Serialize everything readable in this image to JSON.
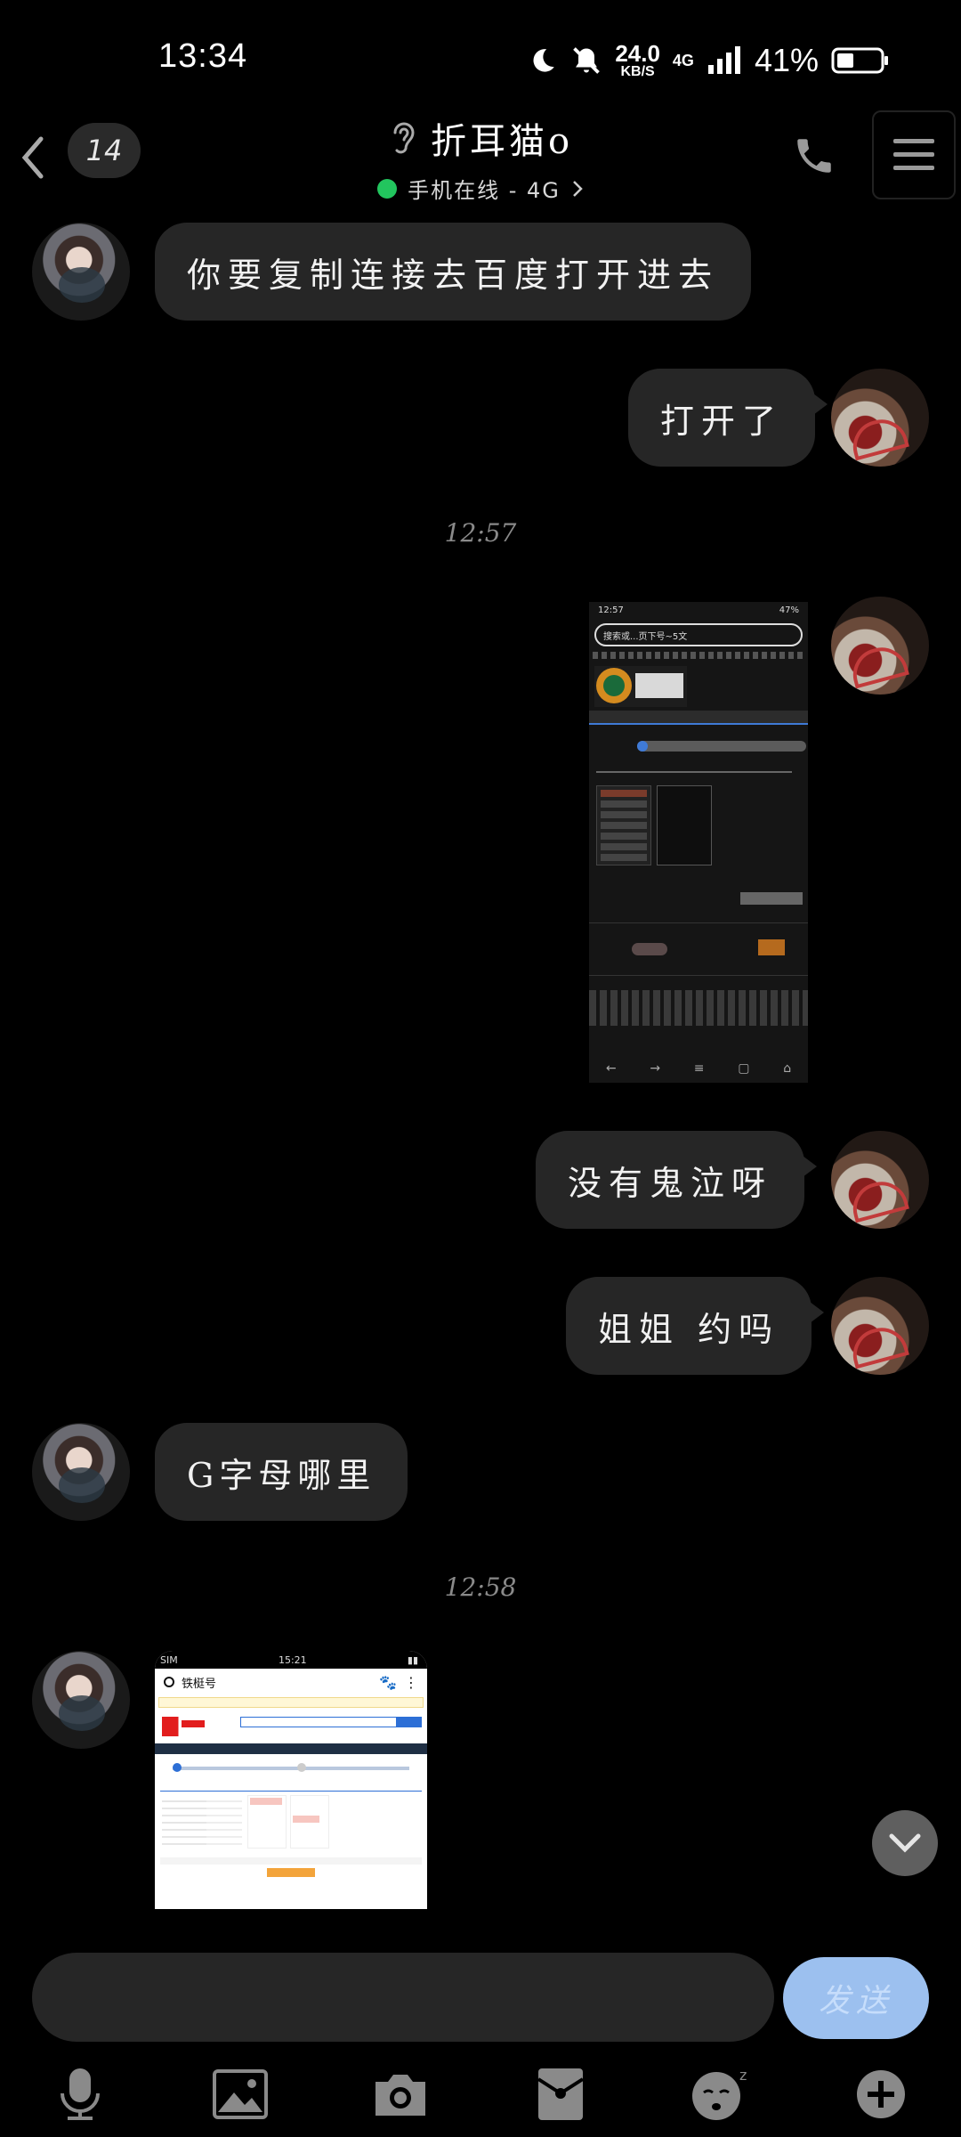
{
  "status_bar": {
    "time": "13:34",
    "net_speed_value": "24.0",
    "net_speed_unit": "KB/S",
    "network": "4G",
    "battery_percent": "41%"
  },
  "header": {
    "unread_count": "14",
    "contact_name": "折耳猫o",
    "status_text": "手机在线 - 4G"
  },
  "messages": [
    {
      "side": "left",
      "text": "你要复制连接去百度打开进去"
    },
    {
      "side": "right",
      "text": "打开了"
    },
    {
      "timestamp": "12:57"
    },
    {
      "side": "right",
      "type": "image"
    },
    {
      "side": "right",
      "text": "没有鬼泣呀"
    },
    {
      "side": "right",
      "text": "姐姐 约吗"
    },
    {
      "side": "left",
      "text": "G字母哪里"
    },
    {
      "timestamp": "12:58"
    },
    {
      "side": "left",
      "type": "image"
    }
  ],
  "thumb1": {
    "time": "12:57",
    "battery": "47%",
    "url_text": "搜索或...页下号~5文"
  },
  "thumb2": {
    "carrier": "SIM",
    "time": "15:21",
    "search_text": "铁梃号"
  },
  "composer": {
    "send_label": "发送"
  },
  "colors": {
    "background": "#000000",
    "bubble": "#262626",
    "online": "#22c55e",
    "send_button": "#9cc0ef"
  },
  "toolbar_icons": [
    "microphone-icon",
    "image-icon",
    "camera-icon",
    "red-packet-icon",
    "emoji-icon",
    "plus-icon"
  ]
}
